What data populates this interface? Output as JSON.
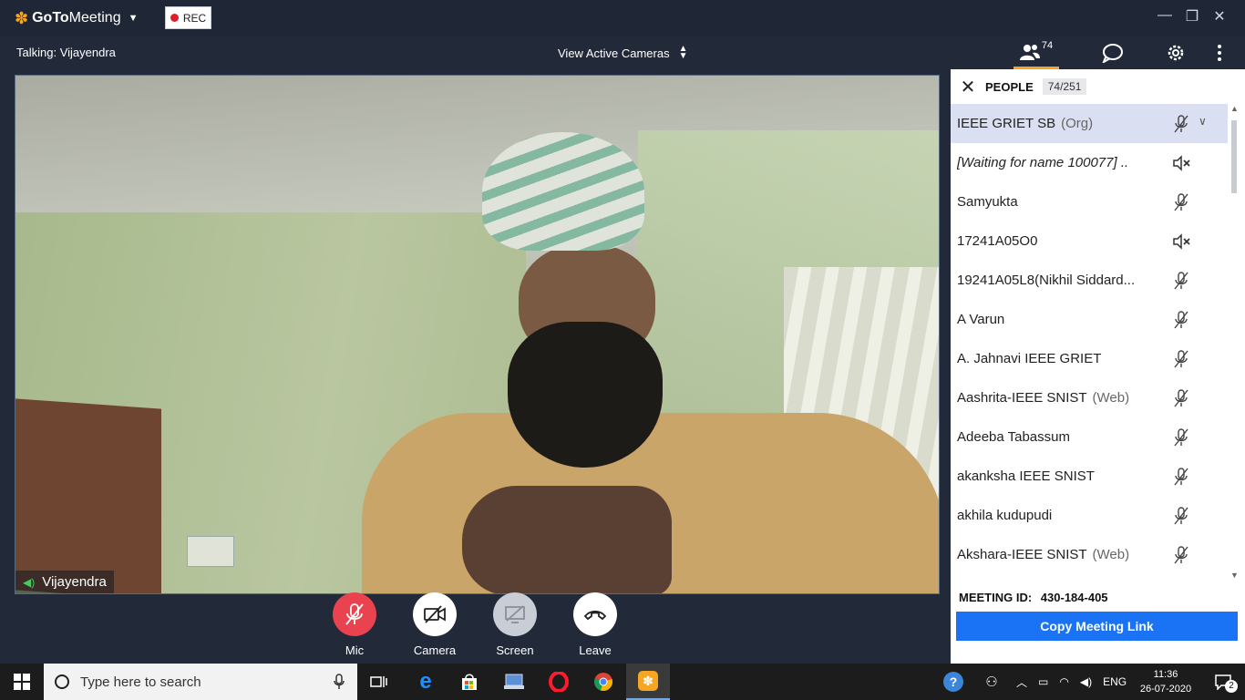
{
  "app": {
    "brand_prefix": "GoTo",
    "brand_suffix": "Meeting",
    "rec_label": "REC"
  },
  "subbar": {
    "talking": "Talking: Vijayendra",
    "view_cameras": "View Active Cameras",
    "people_count": "74"
  },
  "video": {
    "speaker_name": "Vijayendra"
  },
  "controls": {
    "mic": "Mic",
    "camera": "Camera",
    "screen": "Screen",
    "leave": "Leave"
  },
  "people_panel": {
    "title": "PEOPLE",
    "count": "74/251",
    "participants": [
      {
        "name": "IEEE GRIET SB",
        "tag": "(Org)",
        "mic": "muted",
        "selected": true
      },
      {
        "name": "[Waiting for name 100077]  ..",
        "tag": "",
        "mic": "speaker-off",
        "italic": true
      },
      {
        "name": " Samyukta",
        "tag": "",
        "mic": "muted"
      },
      {
        "name": "17241A05O0",
        "tag": "",
        "mic": "speaker-off"
      },
      {
        "name": "19241A05L8(Nikhil Siddard...",
        "tag": "",
        "mic": "muted"
      },
      {
        "name": "A Varun",
        "tag": "",
        "mic": "muted"
      },
      {
        "name": "A. Jahnavi IEEE GRIET",
        "tag": "",
        "mic": "muted"
      },
      {
        "name": "Aashrita-IEEE SNIST",
        "tag": "(Web)",
        "mic": "muted"
      },
      {
        "name": "Adeeba Tabassum",
        "tag": "",
        "mic": "muted"
      },
      {
        "name": "akanksha IEEE SNIST",
        "tag": "",
        "mic": "muted"
      },
      {
        "name": "akhila kudupudi",
        "tag": "",
        "mic": "muted"
      },
      {
        "name": "Akshara-IEEE SNIST",
        "tag": "(Web)",
        "mic": "muted"
      }
    ],
    "meeting_id_label": "MEETING ID:",
    "meeting_id": "430-184-405",
    "copy_link": "Copy Meeting Link"
  },
  "taskbar": {
    "search_placeholder": "Type here to search",
    "language": "ENG",
    "time": "11:36",
    "date": "26-07-2020",
    "notifications": "2"
  },
  "colors": {
    "accent_orange": "#f5a623",
    "mic_red": "#e8434f",
    "copy_blue": "#1a73f5",
    "selected_row": "#dadff2"
  }
}
